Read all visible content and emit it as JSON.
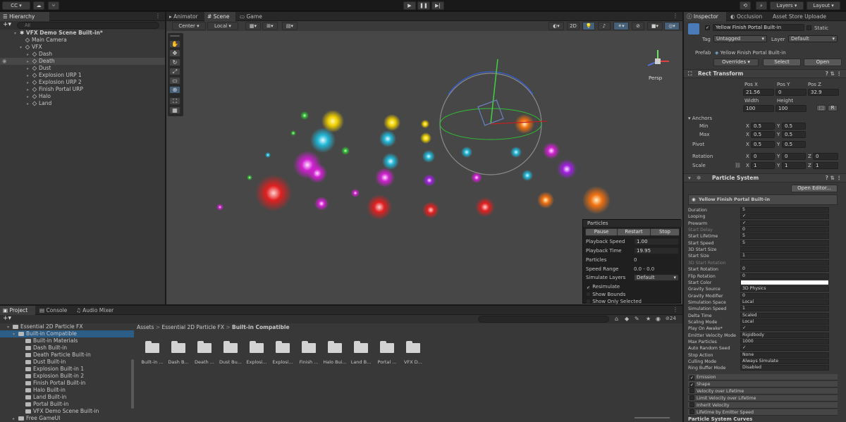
{
  "toolbar": {
    "account": "CC",
    "layers": "Layers",
    "layout": "Layout"
  },
  "hierarchy": {
    "tab": "Hierarchy",
    "search_placeholder": "All",
    "scene": "VFX Demo Scene Built-in*",
    "items": [
      "Main Camera",
      "VFX",
      "Dash",
      "Death",
      "Dust",
      "Explosion URP 1",
      "Explosion URP 2",
      "Finish Portal URP",
      "Halo",
      "Land"
    ]
  },
  "scene_tabs": [
    "Animator",
    "Scene",
    "Game"
  ],
  "scene_toolbar": {
    "pivot": "Center",
    "space": "Local",
    "mode_2d": "2D",
    "gizmo_count": "24"
  },
  "persp_label": "Persp",
  "particles_overlay": {
    "title": "Particles",
    "buttons": [
      "Pause",
      "Restart",
      "Stop"
    ],
    "rows": [
      {
        "label": "Playback Speed",
        "value": "1.00"
      },
      {
        "label": "Playback Time",
        "value": "19.95"
      },
      {
        "label": "Particles",
        "value": "0"
      },
      {
        "label": "Speed Range",
        "value": "0.0 - 0.0"
      },
      {
        "label": "Simulate Layers",
        "value": "Default"
      }
    ],
    "checks": [
      {
        "label": "Resimulate",
        "checked": true
      },
      {
        "label": "Show Bounds",
        "checked": false
      },
      {
        "label": "Show Only Selected",
        "checked": false
      }
    ]
  },
  "project": {
    "tabs": [
      "Project",
      "Console",
      "Audio Mixer"
    ],
    "tree_root": "Essential 2D Particle FX",
    "tree_selected": "Built-in Compatible",
    "tree_items": [
      "Built-in Materials",
      "Dash Built-in",
      "Death Particle Built-in",
      "Dust Built-in",
      "Explosion Built-in 1",
      "Explosion Built-in 2",
      "Finish Portal Built-in",
      "Halo Built-in",
      "Land Built-in",
      "Portal Built-in",
      "VFX Demo Scene Built-in"
    ],
    "tree_last": "Free GameUI",
    "breadcrumb": [
      "Assets",
      "Essential 2D Particle FX",
      "Built-in Compatible"
    ],
    "tiles": [
      "Built-in ...",
      "Dash B...",
      "Death ...",
      "Dust Bu...",
      "Explosi...",
      "Explosi...",
      "Finish ...",
      "Halo Bui...",
      "Land B...",
      "Portal ...",
      "VFX D..."
    ],
    "icon_count": "24"
  },
  "inspector": {
    "tabs": [
      "Inspector",
      "Occlusion",
      "Asset Store Uploade"
    ],
    "object_name": "Yellow Finish Portal Built-in",
    "static_label": "Static",
    "tag_label": "Tag",
    "tag": "Untagged",
    "layer_label": "Layer",
    "layer": "Default",
    "prefab_label": "Prefab",
    "prefab": "Yellow Finish Portal Built-in",
    "overrides": "Overrides",
    "select": "Select",
    "open": "Open",
    "rect_transform": {
      "title": "Rect Transform",
      "pos_x_label": "Pos X",
      "pos_y_label": "Pos Y",
      "pos_z_label": "Pos Z",
      "pos_x": "21.56",
      "pos_y": "0",
      "pos_z": "32.9",
      "width_label": "Width",
      "height_label": "Height",
      "width": "100",
      "height": "100",
      "anchors": "Anchors",
      "min": "Min",
      "max": "Max",
      "pivot": "Pivot",
      "min_x": "0.5",
      "min_y": "0.5",
      "max_x": "0.5",
      "max_y": "0.5",
      "pivot_x": "0.5",
      "pivot_y": "0.5",
      "rotation": "Rotation",
      "rot_x": "0",
      "rot_y": "0",
      "rot_z": "0",
      "scale": "Scale",
      "scale_x": "1",
      "scale_y": "1",
      "scale_z": "1",
      "r_button": "R"
    },
    "particle_system": {
      "title": "Particle System",
      "open_editor": "Open Editor...",
      "sub_title": "Yellow Finish Portal Built-in",
      "rows": [
        {
          "label": "Duration",
          "value": "5"
        },
        {
          "label": "Looping",
          "value": "✓"
        },
        {
          "label": "Prewarm",
          "value": "✓"
        },
        {
          "label": "Start Delay",
          "value": "0"
        },
        {
          "label": "Start Lifetime",
          "value": "5"
        },
        {
          "label": "Start Speed",
          "value": "5"
        },
        {
          "label": "3D Start Size",
          "value": ""
        },
        {
          "label": "Start Size",
          "value": "1"
        },
        {
          "label": "3D Start Rotation",
          "value": ""
        },
        {
          "label": "Start Rotation",
          "value": "0"
        },
        {
          "label": "Flip Rotation",
          "value": "0"
        },
        {
          "label": "Start Color",
          "value": ""
        },
        {
          "label": "Gravity Source",
          "value": "3D Physics"
        },
        {
          "label": "Gravity Modifier",
          "value": "0"
        },
        {
          "label": "Simulation Space",
          "value": "Local"
        },
        {
          "label": "Simulation Speed",
          "value": "1"
        },
        {
          "label": "Delta Time",
          "value": "Scaled"
        },
        {
          "label": "Scaling Mode",
          "value": "Local"
        },
        {
          "label": "Play On Awake*",
          "value": "✓"
        },
        {
          "label": "Emitter Velocity Mode",
          "value": "Rigidbody"
        },
        {
          "label": "Max Particles",
          "value": "1000"
        },
        {
          "label": "Auto Random Seed",
          "value": "✓"
        },
        {
          "label": "Stop Action",
          "value": "None"
        },
        {
          "label": "Culling Mode",
          "value": "Always Simulate"
        },
        {
          "label": "Ring Buffer Mode",
          "value": "Disabled"
        }
      ],
      "modules": [
        "Emission",
        "Shape",
        "Velocity over Lifetime",
        "Limit Velocity over Lifetime",
        "Inherit Velocity",
        "Lifetime by Emitter Speed"
      ],
      "curves": "Particle System Curves"
    }
  },
  "colors": {
    "selection": "#2c5d87",
    "panel": "#383838",
    "scene_bg": "#474747"
  }
}
